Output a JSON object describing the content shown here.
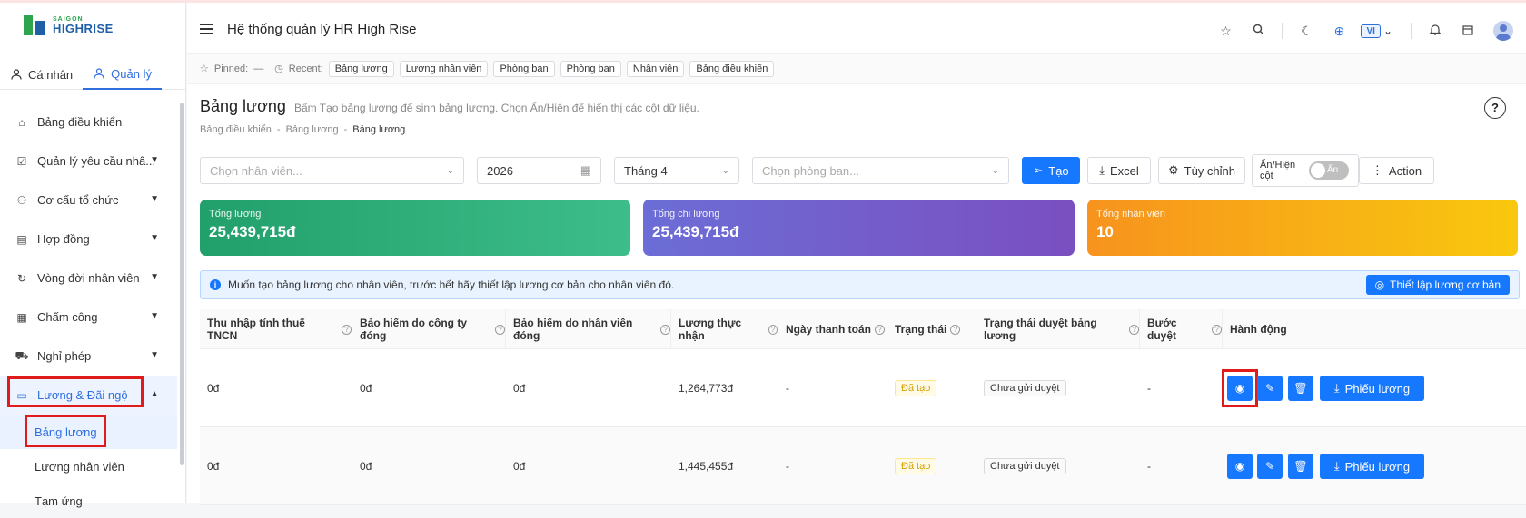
{
  "brand": {
    "line1": "SAIGON",
    "line2": "HIGHRISE"
  },
  "sidebar": {
    "tabs": [
      {
        "label": "Cá nhân"
      },
      {
        "label": "Quản lý"
      }
    ],
    "items": [
      {
        "label": "Bảng điều khiển"
      },
      {
        "label": "Quản lý yêu cầu nhâ..."
      },
      {
        "label": "Cơ cấu tổ chức"
      },
      {
        "label": "Hợp đồng"
      },
      {
        "label": "Vòng đời nhân viên"
      },
      {
        "label": "Chấm công"
      },
      {
        "label": "Nghỉ phép"
      },
      {
        "label": "Lương & Đãi ngộ"
      }
    ],
    "subitems": [
      {
        "label": "Bảng lương"
      },
      {
        "label": "Lương nhân viên"
      },
      {
        "label": "Tạm ứng"
      }
    ]
  },
  "header": {
    "title": "Hệ thống quản lý HR High Rise",
    "lang": "VI"
  },
  "pinbar": {
    "pinned_label": "Pinned:",
    "pinned_value": "—",
    "recent_label": "Recent:",
    "recent": [
      "Bảng lương",
      "Lương nhân viên",
      "Phòng ban",
      "Phòng ban",
      "Nhân viên",
      "Bảng điều khiển"
    ]
  },
  "page": {
    "title": "Bảng lương",
    "hint": "Bấm Tạo bảng lương để sinh bảng lương. Chọn Ẩn/Hiện để hiển thị các cột dữ liệu.",
    "breadcrumb": [
      "Bảng điều khiển",
      "-",
      "Bảng lương",
      "-",
      "Bảng lương"
    ]
  },
  "filters": {
    "employee_placeholder": "Chọn nhân viên...",
    "year": "2026",
    "month": "Tháng 4",
    "department_placeholder": "Chọn phòng ban...",
    "create": "Tạo",
    "excel": "Excel",
    "customize": "Tùy chỉnh",
    "toggle_label": "Ẩn/Hiện cột",
    "toggle_state": "Ẩn",
    "action": "Action"
  },
  "cards": [
    {
      "label": "Tổng lương",
      "value": "25,439,715đ",
      "color": "#22a06b"
    },
    {
      "label": "Tổng chi lương",
      "value": "25,439,715đ",
      "color": "#6c5dd3"
    },
    {
      "label": "Tổng nhân viên",
      "value": "10",
      "color": "#f5a623"
    }
  ],
  "info": {
    "text": "Muốn tạo bảng lương cho nhân viên, trước hết hãy thiết lập lương cơ bản cho nhân viên đó.",
    "button": "Thiết lập lương cơ bản"
  },
  "table": {
    "columns": [
      "Thu nhập tính thuế TNCN",
      "Bảo hiểm do công ty đóng",
      "Bảo hiểm do nhân viên đóng",
      "Lương thực nhận",
      "Ngày thanh toán",
      "Trạng thái",
      "Trạng thái duyệt bảng lương",
      "Bước duyệt",
      "Hành động"
    ],
    "rows": [
      {
        "taxable": "0đ",
        "ins_company": "0đ",
        "ins_employee": "0đ",
        "net": "1,264,773đ",
        "paid": "-",
        "status": "Đã tạo",
        "approval": "Chưa gửi duyệt",
        "step": "-",
        "slip": "Phiếu lương"
      },
      {
        "taxable": "0đ",
        "ins_company": "0đ",
        "ins_employee": "0đ",
        "net": "1,445,455đ",
        "paid": "-",
        "status": "Đã tạo",
        "approval": "Chưa gửi duyệt",
        "step": "-",
        "slip": "Phiếu lương"
      }
    ]
  }
}
